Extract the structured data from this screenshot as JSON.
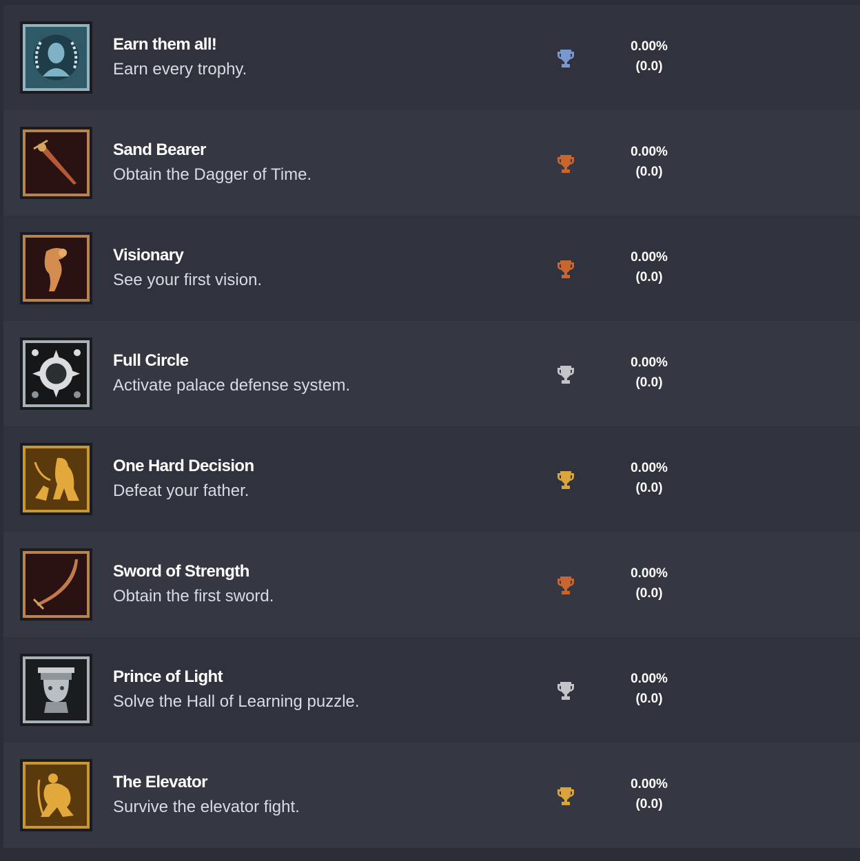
{
  "colors": {
    "platinum": "#7a97cf",
    "bronze": "#c9662f",
    "silver": "#c2c4c8",
    "gold": "#d9a43c"
  },
  "trophies": [
    {
      "title": "Earn them all!",
      "description": "Earn every trophy.",
      "grade": "platinum",
      "icon": "laurel-head-icon",
      "rarity": "0.00%",
      "count": "(0.0)"
    },
    {
      "title": "Sand Bearer",
      "description": "Obtain the Dagger of Time.",
      "grade": "bronze",
      "icon": "dagger-icon",
      "rarity": "0.00%",
      "count": "(0.0)"
    },
    {
      "title": "Visionary",
      "description": "See your first vision.",
      "grade": "bronze",
      "icon": "vision-figure-icon",
      "rarity": "0.00%",
      "count": "(0.0)"
    },
    {
      "title": "Full Circle",
      "description": "Activate palace defense system.",
      "grade": "silver",
      "icon": "sun-disc-icon",
      "rarity": "0.00%",
      "count": "(0.0)"
    },
    {
      "title": "One Hard Decision",
      "description": "Defeat your father.",
      "grade": "gold",
      "icon": "duel-icon",
      "rarity": "0.00%",
      "count": "(0.0)"
    },
    {
      "title": "Sword of Strength",
      "description": "Obtain the first sword.",
      "grade": "bronze",
      "icon": "sword-icon",
      "rarity": "0.00%",
      "count": "(0.0)"
    },
    {
      "title": "Prince of Light",
      "description": "Solve the Hall of Learning puzzle.",
      "grade": "silver",
      "icon": "statue-faces-icon",
      "rarity": "0.00%",
      "count": "(0.0)"
    },
    {
      "title": "The Elevator",
      "description": "Survive the elevator fight.",
      "grade": "gold",
      "icon": "kneeling-warrior-icon",
      "rarity": "0.00%",
      "count": "(0.0)"
    }
  ]
}
